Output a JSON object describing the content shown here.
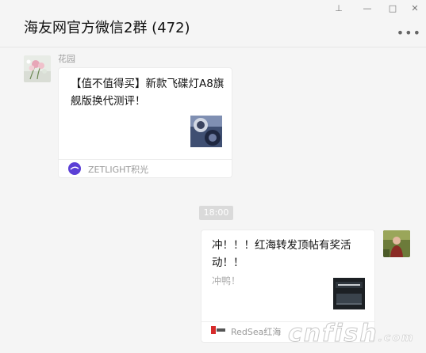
{
  "header": {
    "title": "海友网官方微信2群 (472)",
    "more_label": "•••"
  },
  "window_controls": {
    "pin": "⊥",
    "minimize": "—",
    "maximize": "□",
    "close": "✕"
  },
  "messages": [
    {
      "sender": "花园",
      "card": {
        "title": "【值不值得买】新款飞碟灯A8旗舰版换代测评！",
        "source": "ZETLIGHT积光"
      }
    },
    {
      "time": "18:00"
    },
    {
      "card": {
        "title": "冲！！！红海转发顶帖有奖活动！！",
        "desc": "冲鸭！",
        "source": "RedSea红海"
      }
    }
  ],
  "watermark": {
    "main": "cnfish",
    "suffix": ".com"
  },
  "colors": {
    "background": "#f5f5f5",
    "card": "#ffffff",
    "time_badge": "#dadada"
  }
}
